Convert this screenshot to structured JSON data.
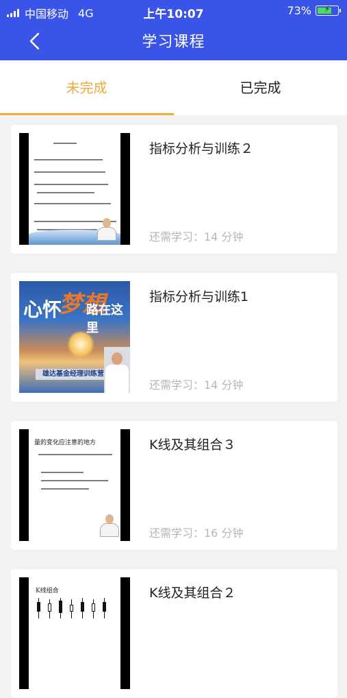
{
  "status_bar": {
    "carrier": "中国移动",
    "network": "4G",
    "time": "上午10:07",
    "battery": "73%",
    "battery_level": 0.73
  },
  "nav": {
    "title": "学习课程",
    "back_icon": "chevron-left-icon"
  },
  "tabs": [
    {
      "label": "未完成",
      "active": true
    },
    {
      "label": "已完成",
      "active": false
    }
  ],
  "colors": {
    "header_bg": "#3a54e8",
    "accent": "#f0a93a",
    "muted_text": "#b5b5b5",
    "page_bg": "#f2f2f2"
  },
  "courses": [
    {
      "title": "指标分析与训练２",
      "remaining": "还需学习：14 分钟"
    },
    {
      "title": "指标分析与训练1",
      "remaining": "还需学习：14 分钟"
    },
    {
      "title": "K线及其组合３",
      "remaining": "还需学习：16 分钟"
    },
    {
      "title": "K线及其组合２",
      "remaining": ""
    }
  ],
  "thumbnails": {
    "course_2": {
      "text1": "心怀",
      "text2": "梦想",
      "text3": "路在这里",
      "band": "雄达基金经理训练营"
    },
    "course_3": {
      "heading": "量的变化应注意的地方"
    },
    "course_4": {
      "heading": "K线组合"
    }
  }
}
